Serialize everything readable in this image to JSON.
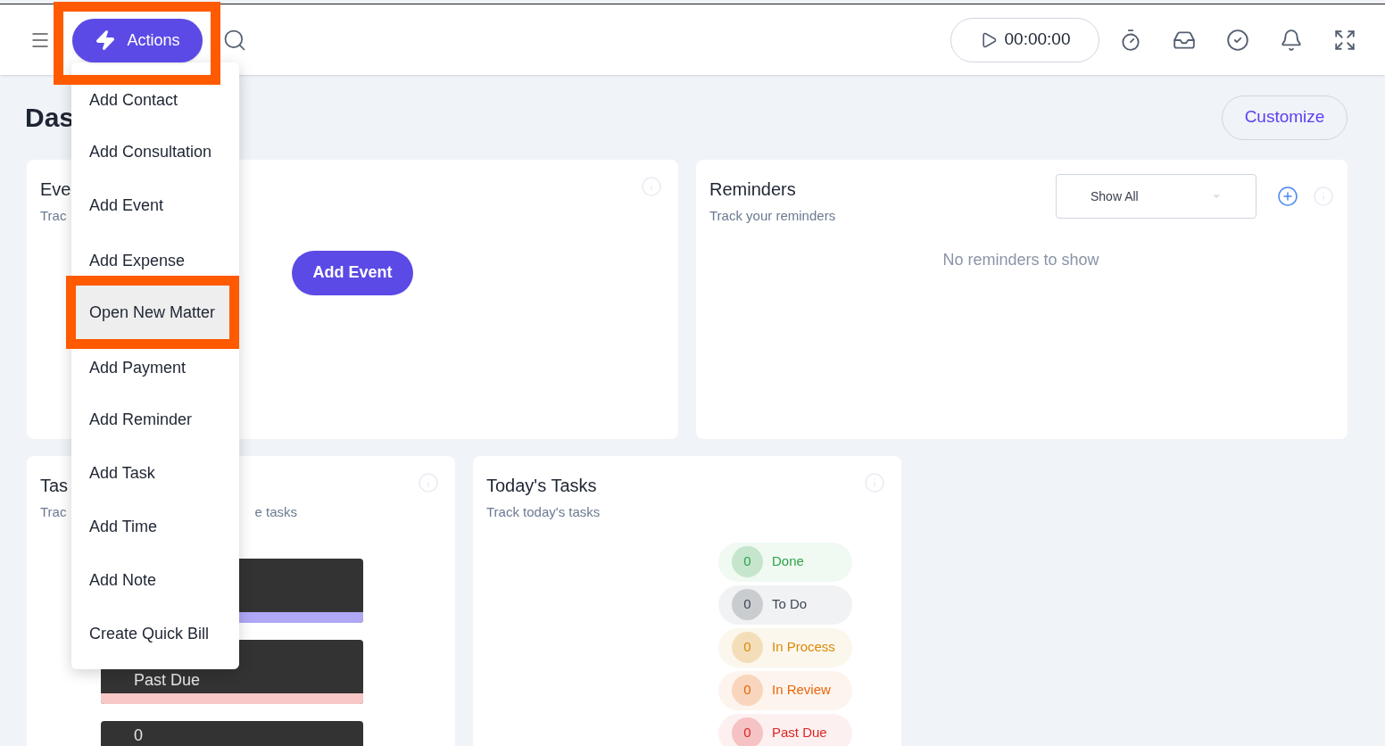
{
  "topbar": {
    "actions_button": {
      "label": "Actions",
      "annotated": true
    },
    "timer": "00:00:00"
  },
  "actions_menu": [
    {
      "label": "Add Contact",
      "selected": false,
      "annotated": false
    },
    {
      "label": "Add Consultation",
      "selected": false,
      "annotated": false
    },
    {
      "label": "Add Event",
      "selected": false,
      "annotated": false
    },
    {
      "label": "Add Expense",
      "selected": false,
      "annotated": false
    },
    {
      "label": "Open New Matter",
      "selected": true,
      "annotated": true
    },
    {
      "label": "Add Payment",
      "selected": false,
      "annotated": false
    },
    {
      "label": "Add Reminder",
      "selected": false,
      "annotated": false
    },
    {
      "label": "Add Task",
      "selected": false,
      "annotated": false
    },
    {
      "label": "Add Time",
      "selected": false,
      "annotated": false
    },
    {
      "label": "Add Note",
      "selected": false,
      "annotated": false
    },
    {
      "label": "Create Quick Bill",
      "selected": false,
      "annotated": false
    }
  ],
  "page_title": "Das",
  "customize_button": "Customize",
  "events_card": {
    "title": "Eve",
    "subtitle": "Trac",
    "button": "Add Event"
  },
  "reminders_card": {
    "title": "Reminders",
    "subtitle": "Track your reminders",
    "filter": "Show All",
    "empty_text": "No reminders to show"
  },
  "tasks_card": {
    "title": "Tas",
    "subtitle_start": "Trac",
    "subtitle_end": "e tasks",
    "bars": [
      {
        "color": "#b0a8f5"
      },
      {
        "text": "Past Due",
        "color": "#f8c8c8"
      },
      {
        "text": "0"
      }
    ]
  },
  "todays_tasks_card": {
    "title": "Today's Tasks",
    "subtitle": "Track today's tasks",
    "statuses": [
      {
        "count": "0",
        "label": "Done",
        "color": "#2fa34a"
      },
      {
        "count": "0",
        "label": "To Do",
        "color": "#3f4756"
      },
      {
        "count": "0",
        "label": "In Process",
        "color": "#d98a06"
      },
      {
        "count": "0",
        "label": "In Review",
        "color": "#e8670c"
      },
      {
        "count": "0",
        "label": "Past Due",
        "color": "#dc2626"
      }
    ]
  }
}
